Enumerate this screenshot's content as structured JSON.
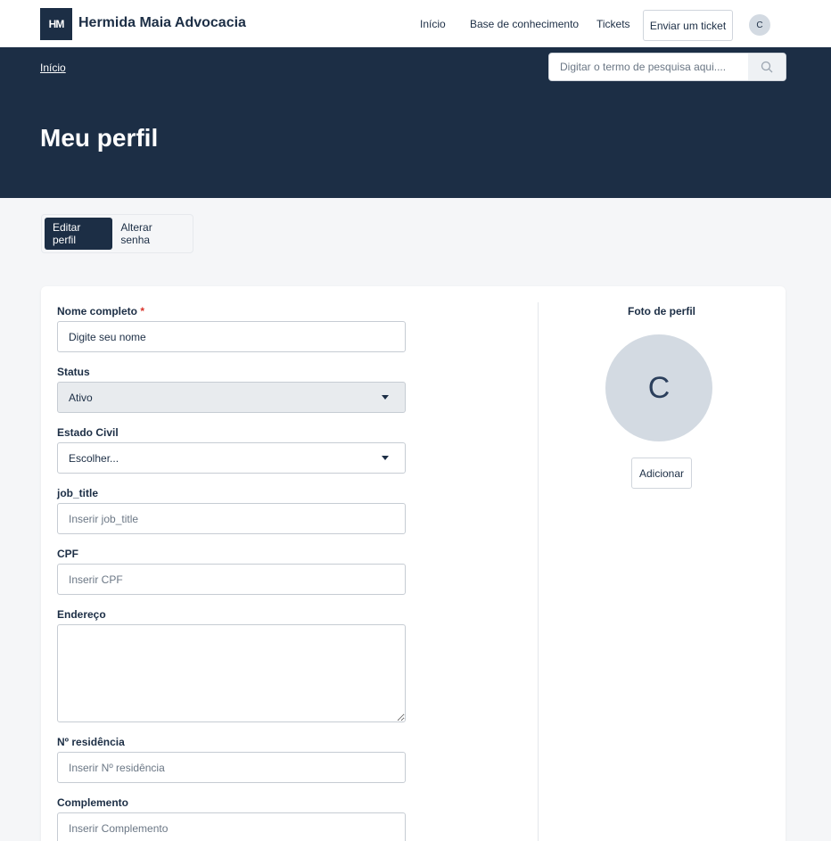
{
  "brand": {
    "logo_text": "HM",
    "name": "Hermida Maia Advocacia"
  },
  "nav": {
    "links": [
      "Início",
      "Base de conhecimento",
      "Tickets"
    ],
    "submit_ticket": "Enviar um ticket",
    "user_initial": "C"
  },
  "hero": {
    "breadcrumb": "Início",
    "search_placeholder": "Digitar o termo de pesquisa aqui....",
    "title": "Meu perfil"
  },
  "tabs": [
    {
      "label": "Editar perfil",
      "active": true
    },
    {
      "label": "Alterar senha",
      "active": false
    }
  ],
  "form": {
    "full_name": {
      "label": "Nome completo",
      "required_mark": "*",
      "value": "Digite seu nome"
    },
    "status": {
      "label": "Status",
      "value": "Ativo"
    },
    "marital_status": {
      "label": "Estado Civil",
      "value": "Escolher..."
    },
    "job_title": {
      "label": "job_title",
      "placeholder": "Inserir job_title"
    },
    "cpf": {
      "label": "CPF",
      "placeholder": "Inserir CPF"
    },
    "address": {
      "label": "Endereço"
    },
    "residence_number": {
      "label": "Nº residência",
      "placeholder": "Inserir Nº residência"
    },
    "complement": {
      "label": "Complemento",
      "placeholder": "Inserir Complemento"
    }
  },
  "photo": {
    "label": "Foto de perfil",
    "initial": "C",
    "add_button": "Adicionar"
  },
  "colors": {
    "primary": "#1c2e45",
    "avatar_bg": "#d3dae2",
    "required": "#d9342b"
  }
}
